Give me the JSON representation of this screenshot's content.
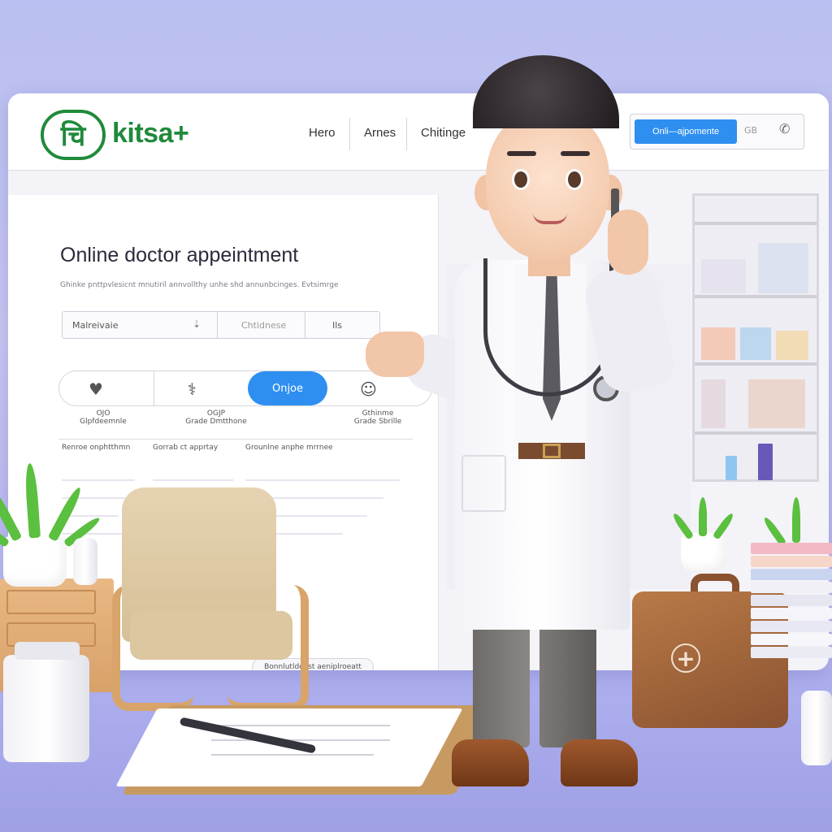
{
  "header": {
    "logo_mark": "चि",
    "logo_text": "kitsa+",
    "nav": [
      "Hero",
      "Arnes",
      "Chitinge"
    ],
    "cta_label": "Onli—ajpomente",
    "cta_mid": "GB",
    "phone_icon": "phone-icon"
  },
  "hero": {
    "headline": "Online doctor appeintment",
    "subline": "Ghinke pnttpvlesicnt mnutiril annvollthy unhe shd annunbcinges. Evtsimrge"
  },
  "search": {
    "field1": "Malreivaie",
    "field2": "Chtidnese",
    "field3": "Ils"
  },
  "services": {
    "button": "Onjoe",
    "items": [
      {
        "icon": "heart-icon",
        "line1": "OJO",
        "line2": "Glpfdeemnle"
      },
      {
        "icon": "medical-icon",
        "line1": "OGJP",
        "line2": "Grade Dmtthone"
      },
      {
        "icon": "doctor-icon",
        "line1": "Gthinme",
        "line2": "Grade Sbrille"
      }
    ]
  },
  "columns": [
    "Renroe onphtthmn",
    "Gorrab ct apprtay",
    "Grounlne anphe mrrnee"
  ],
  "footer_pill": "Bonnlutldeost aeniplroeatt"
}
